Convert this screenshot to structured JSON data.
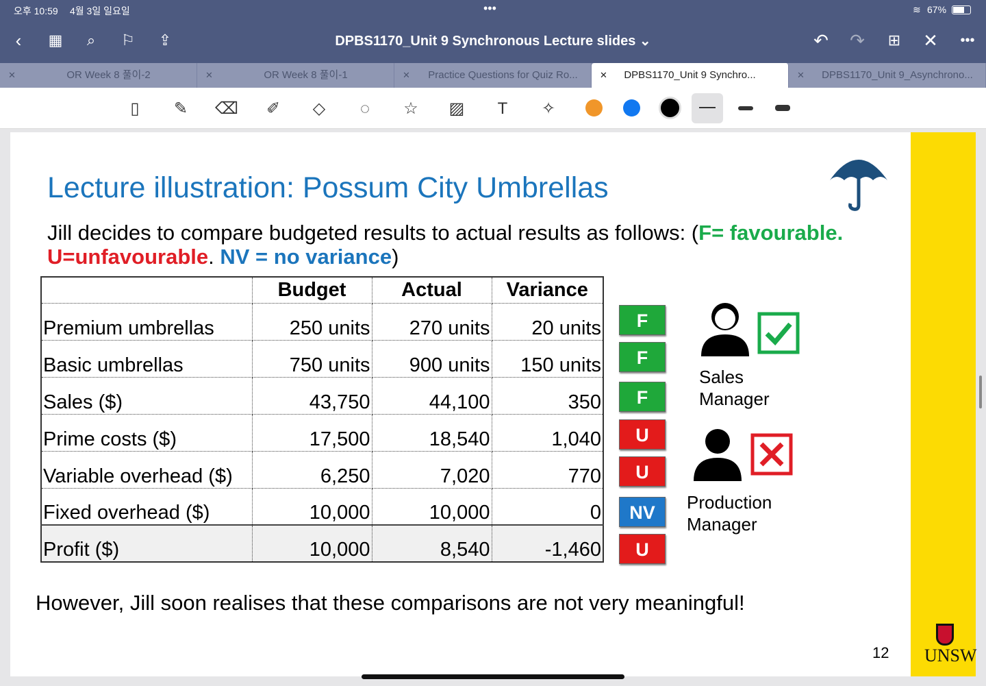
{
  "status": {
    "time": "오후 10:59",
    "date": "4월 3일 일요일",
    "battery": "67%"
  },
  "header": {
    "title": "DPBS1170_Unit 9 Synchronous Lecture slides ⌄"
  },
  "tabs": [
    {
      "label": "OR Week 8 풀이-2"
    },
    {
      "label": "OR Week 8 풀이-1"
    },
    {
      "label": "Practice Questions for Quiz Ro..."
    },
    {
      "label": "DPBS1170_Unit 9 Synchro...",
      "active": true
    },
    {
      "label": "DPBS1170_Unit 9_Asynchrono..."
    }
  ],
  "colors": {
    "orange": "#f0962a",
    "blue": "#1178f0",
    "black": "#000000"
  },
  "slide": {
    "title": "Lecture illustration: Possum City Umbrellas",
    "intro": "Jill decides to compare budgeted results to actual results as follows: (",
    "f_label": "F= favourable.",
    "u_label": "U=unfavourable",
    "sep": ". ",
    "nv_label": "NV = no variance",
    "close": ")",
    "table": {
      "headers": [
        "",
        "Budget",
        "Actual",
        "Variance"
      ],
      "rows": [
        [
          "Premium umbrellas",
          "250 units",
          "270 units",
          "20 units"
        ],
        [
          "Basic umbrellas",
          "750 units",
          "900 units",
          "150 units"
        ],
        [
          "Sales ($)",
          "43,750",
          "44,100",
          "350"
        ],
        [
          "Prime costs ($)",
          "17,500",
          "18,540",
          "1,040"
        ],
        [
          "Variable overhead ($)",
          "6,250",
          "7,020",
          "770"
        ],
        [
          "Fixed overhead ($)",
          "10,000",
          "10,000",
          "0"
        ],
        [
          "Profit ($)",
          "10,000",
          "8,540",
          "-1,460"
        ]
      ]
    },
    "badges": [
      "F",
      "F",
      "F",
      "U",
      "U",
      "NV",
      "U"
    ],
    "sales_manager": "Sales Manager",
    "production_manager": "Production Manager",
    "footer": "However, Jill soon realises that these comparisons are not very meaningful!",
    "page": "12",
    "logo": "UNSW SYDNEY"
  }
}
